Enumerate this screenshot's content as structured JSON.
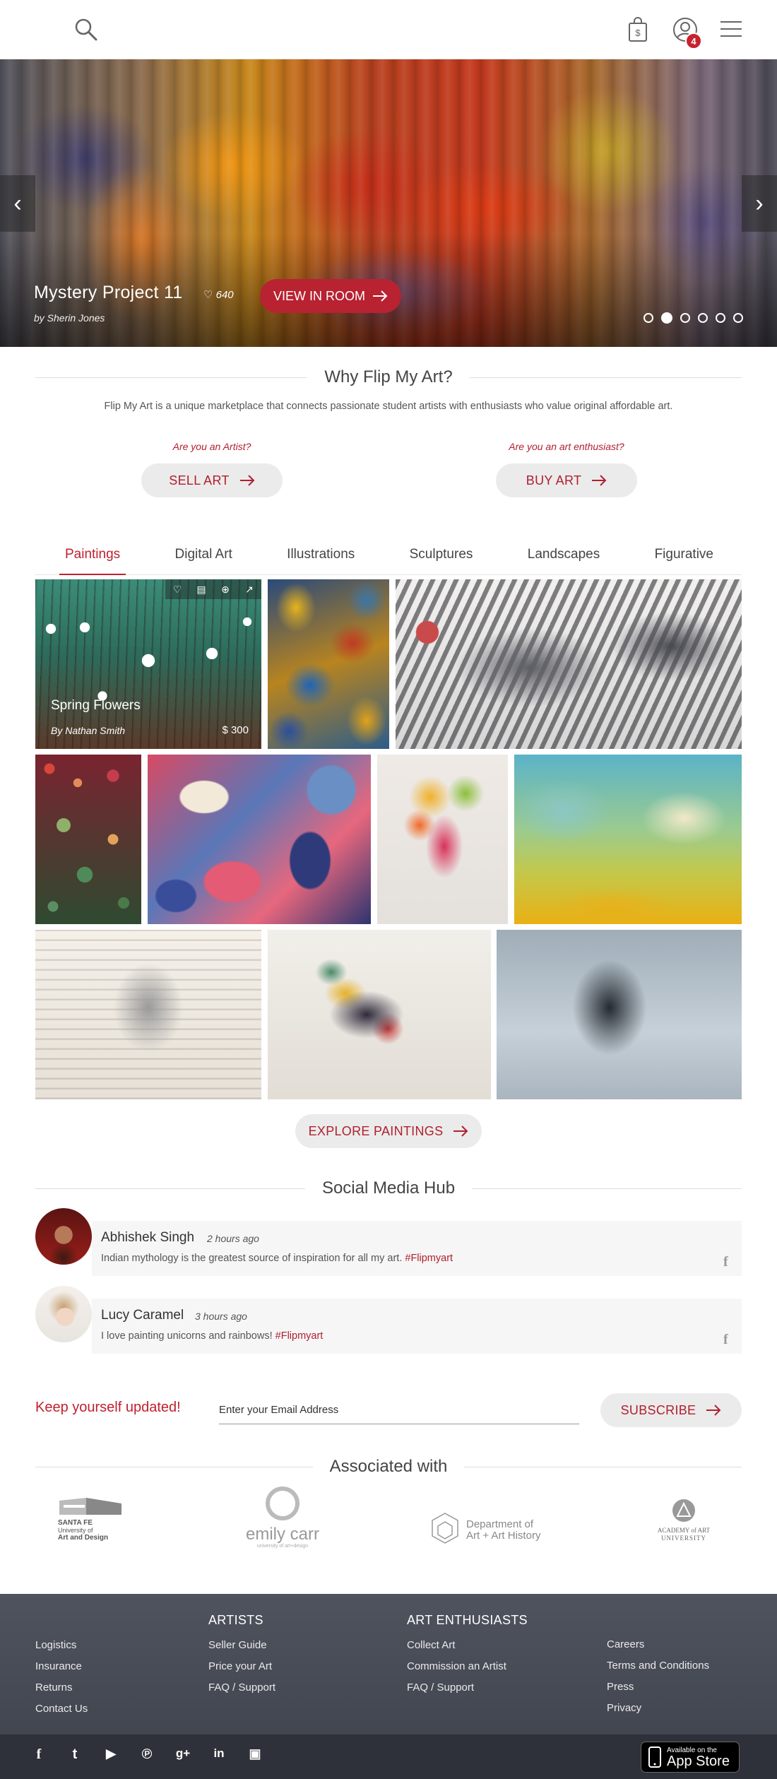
{
  "header": {
    "cart_badge": "4",
    "icons": [
      "search-icon",
      "shopping-bag-icon",
      "user-icon",
      "menu-icon"
    ]
  },
  "hero": {
    "title": "Mystery Project 11",
    "likes": "640",
    "artist": "by Sherin Jones",
    "button_label": "VIEW IN ROOM",
    "slide_count": 6,
    "active_slide": 2
  },
  "why": {
    "title": "Why Flip My Art?",
    "description": "Flip My Art is a unique marketplace that connects passionate student artists with enthusiasts who value original affordable art.",
    "artist_question": "Are you an Artist?",
    "sell_label": "SELL ART",
    "enthusiast_question": "Are you an art enthusiast?",
    "buy_label": "BUY ART"
  },
  "tabs": [
    "Paintings",
    "Digital Art",
    "Illustrations",
    "Sculptures",
    "Landscapes",
    "Figurative"
  ],
  "active_tab": "Paintings",
  "featured_tile": {
    "title": "Spring Flowers",
    "artist": "By Nathan Smith",
    "price": "$ 300"
  },
  "explore_label": "EXPLORE PAINTINGS",
  "social": {
    "title": "Social Media Hub",
    "posts": [
      {
        "name": "Abhishek Singh",
        "time": "2 hours ago",
        "text": "Indian mythology is the greatest source of inspiration for all my art.",
        "tag": "#Flipmyart"
      },
      {
        "name": "Lucy Caramel",
        "time": "3 hours ago",
        "text": "I love painting unicorns and rainbows!",
        "tag": "#Flipmyart"
      }
    ]
  },
  "newsletter": {
    "label": "Keep yourself updated!",
    "placeholder": "Enter your Email Address",
    "button_label": "SUBSCRIBE"
  },
  "associated": {
    "title": "Associated with",
    "logos": [
      {
        "line1": "SANTA FE",
        "line2": "University of",
        "line3": "Art and Design"
      },
      {
        "line1": "emily carr",
        "line2": "university of art+design"
      },
      {
        "line1": "Department of",
        "line2": "Art + Art History"
      },
      {
        "line1": "ACADEMY of ART",
        "line2": "UNIVERSITY"
      }
    ]
  },
  "footer": {
    "col1": [
      "Logistics",
      "Insurance",
      "Returns",
      "Contact Us"
    ],
    "artists_head": "ARTISTS",
    "artists": [
      "Seller Guide",
      "Price your Art",
      "FAQ / Support"
    ],
    "enthusiasts_head": "ART ENTHUSIASTS",
    "enthusiasts": [
      "Collect Art",
      "Commission an Artist",
      "FAQ / Support"
    ],
    "col4": [
      "Careers",
      "Terms and Conditions",
      "Press",
      "Privacy"
    ],
    "social_icons": [
      "facebook-icon",
      "twitter-icon",
      "youtube-icon",
      "pinterest-icon",
      "google-plus-icon",
      "linkedin-icon",
      "instagram-icon"
    ],
    "appstore_small": "Available on the",
    "appstore_big": "App Store"
  },
  "colors": {
    "accent": "#b82231",
    "footer": "#454953"
  }
}
